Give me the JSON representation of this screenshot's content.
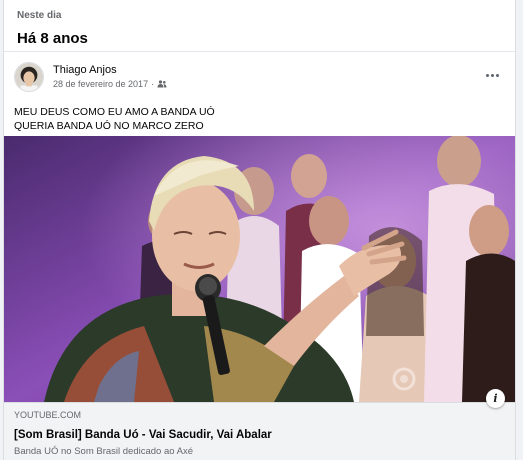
{
  "memory": {
    "label": "Neste dia",
    "title": "Há 8 anos"
  },
  "post": {
    "author": "Thiago Anjos",
    "date": "28 de fevereiro de 2017",
    "separator": "·",
    "audience_icon": "friends-icon",
    "more_icon": "more-horizontal-icon",
    "text_lines": [
      "MEU DEUS COMO EU AMO A BANDA UÓ",
      "QUERIA BANDA UÓ NO MARCO ZERO"
    ]
  },
  "link": {
    "domain": "YOUTUBE.COM",
    "title": "[Som Brasil] Banda Uó - Vai Sacudir, Vai Abalar",
    "description": "Banda UÓ no Som Brasil dedicado ao Axé",
    "info_icon": "i"
  },
  "colors": {
    "card_bg": "#ffffff",
    "page_bg": "#f0f2f5",
    "secondary_text": "#65676b",
    "link_bg": "#f2f3f5",
    "video_stage": "#8b4fb8"
  }
}
